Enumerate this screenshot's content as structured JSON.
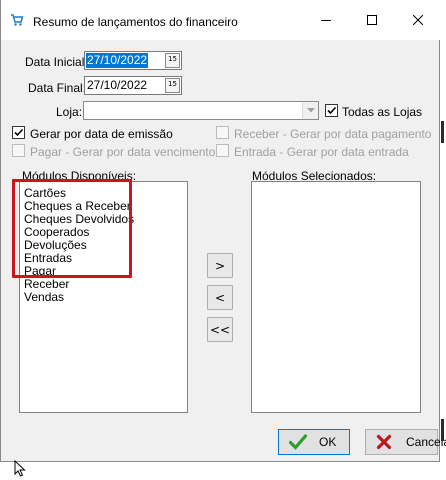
{
  "window": {
    "title": "Resumo de lançamentos do financeiro",
    "icon": "cart-icon"
  },
  "form": {
    "data_inicial_label": "Data Inicial:",
    "data_inicial_value": "27/10/2022",
    "data_final_label": "Data Final:",
    "data_final_value": "27/10/2022",
    "calendar_btn": "15",
    "loja_label": "Loja:",
    "loja_value": "",
    "todas_lojas_label": "Todas as Lojas",
    "todas_lojas_checked": true
  },
  "options": {
    "gerar_emissao": "Gerar por data de emissão",
    "receber_pagamento": "Receber - Gerar por data pagamento",
    "pagar_vencimento": "Pagar - Gerar por data vencimento",
    "entrada_data": "Entrada - Gerar por data entrada"
  },
  "modulos": {
    "disponiveis_label": "Módulos Disponíveis:",
    "selecionados_label": "Módulos Selecionados:",
    "disponiveis": [
      "Cartões",
      "Cheques a Receber",
      "Cheques Devolvidos",
      "Cooperados",
      "Devoluções",
      "Entradas",
      "Pagar",
      "Receber",
      "Vendas"
    ],
    "selecionados": []
  },
  "transfer": {
    "add": ">",
    "remove": "<",
    "remove_all": "<<"
  },
  "actions": {
    "ok": "OK",
    "cancel": "Cancela"
  },
  "colors": {
    "selection": "#0078d7",
    "highlight": "#c8161d",
    "ok_check": "#2e9e2e",
    "cancel_x": "#c0171d"
  }
}
